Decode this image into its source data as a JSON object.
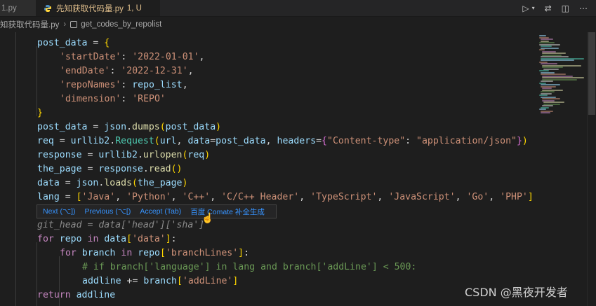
{
  "tabs": {
    "inactive_label": "1.py",
    "active_label": "先知获取代码量.py",
    "active_status": "1, U"
  },
  "breadcrumb": {
    "file": "知获取代码量.py",
    "symbol": "get_codes_by_repolist"
  },
  "code": {
    "l1_var": "post_data",
    "l2_key": "'startDate'",
    "l2_val": "'2022-01-01'",
    "l3_key": "'endDate'",
    "l3_val": "'2022-12-31'",
    "l4_key": "'repoNames'",
    "l4_val": "repo_list",
    "l5_key": "'dimension'",
    "l5_val": "'REPO'",
    "l7_var": "post_data",
    "l7_mod": "json",
    "l7_fn": "dumps",
    "l7_arg": "post_data",
    "l8_var": "req",
    "l8_mod": "urllib2",
    "l8_cls": "Request",
    "l8_a1": "url",
    "l8_kw1": "data",
    "l8_a2": "post_data",
    "l8_kw2": "headers",
    "l8_k": "\"Content-type\"",
    "l8_v": "\"application/json\"",
    "l9_var": "response",
    "l9_mod": "urllib2",
    "l9_fn": "urlopen",
    "l9_arg": "req",
    "l10_var": "the_page",
    "l10_obj": "response",
    "l10_fn": "read",
    "l11_var": "data",
    "l11_mod": "json",
    "l11_fn": "loads",
    "l11_arg": "the_page",
    "l12_var": "lang",
    "l12_items": [
      "'Java'",
      "'Python'",
      "'C++'",
      "'C/C++ Header'",
      "'TypeScript'",
      "'JavaScript'",
      "'Go'",
      "'PHP'"
    ],
    "l13_ghost": "git_head = data['head']['sha']",
    "l14_kw1": "for",
    "l14_var": "repo",
    "l14_kw2": "in",
    "l14_obj": "data",
    "l14_key": "'data'",
    "l15_kw1": "for",
    "l15_var": "branch",
    "l15_kw2": "in",
    "l15_obj": "repo",
    "l15_key": "'branchLines'",
    "l16_comment": "# if branch['language'] in lang and branch['addLine'] < 500:",
    "l17_var": "addline",
    "l17_obj": "branch",
    "l17_key": "'addLine'",
    "l18_kw": "return",
    "l18_var": "addline"
  },
  "hint": {
    "next": "Next (⌥])",
    "previous": "Previous (⌥[)",
    "accept": "Accept (Tab)",
    "provider": "百度 Comate 补全生成"
  },
  "watermark": "CSDN @黑夜开发者"
}
